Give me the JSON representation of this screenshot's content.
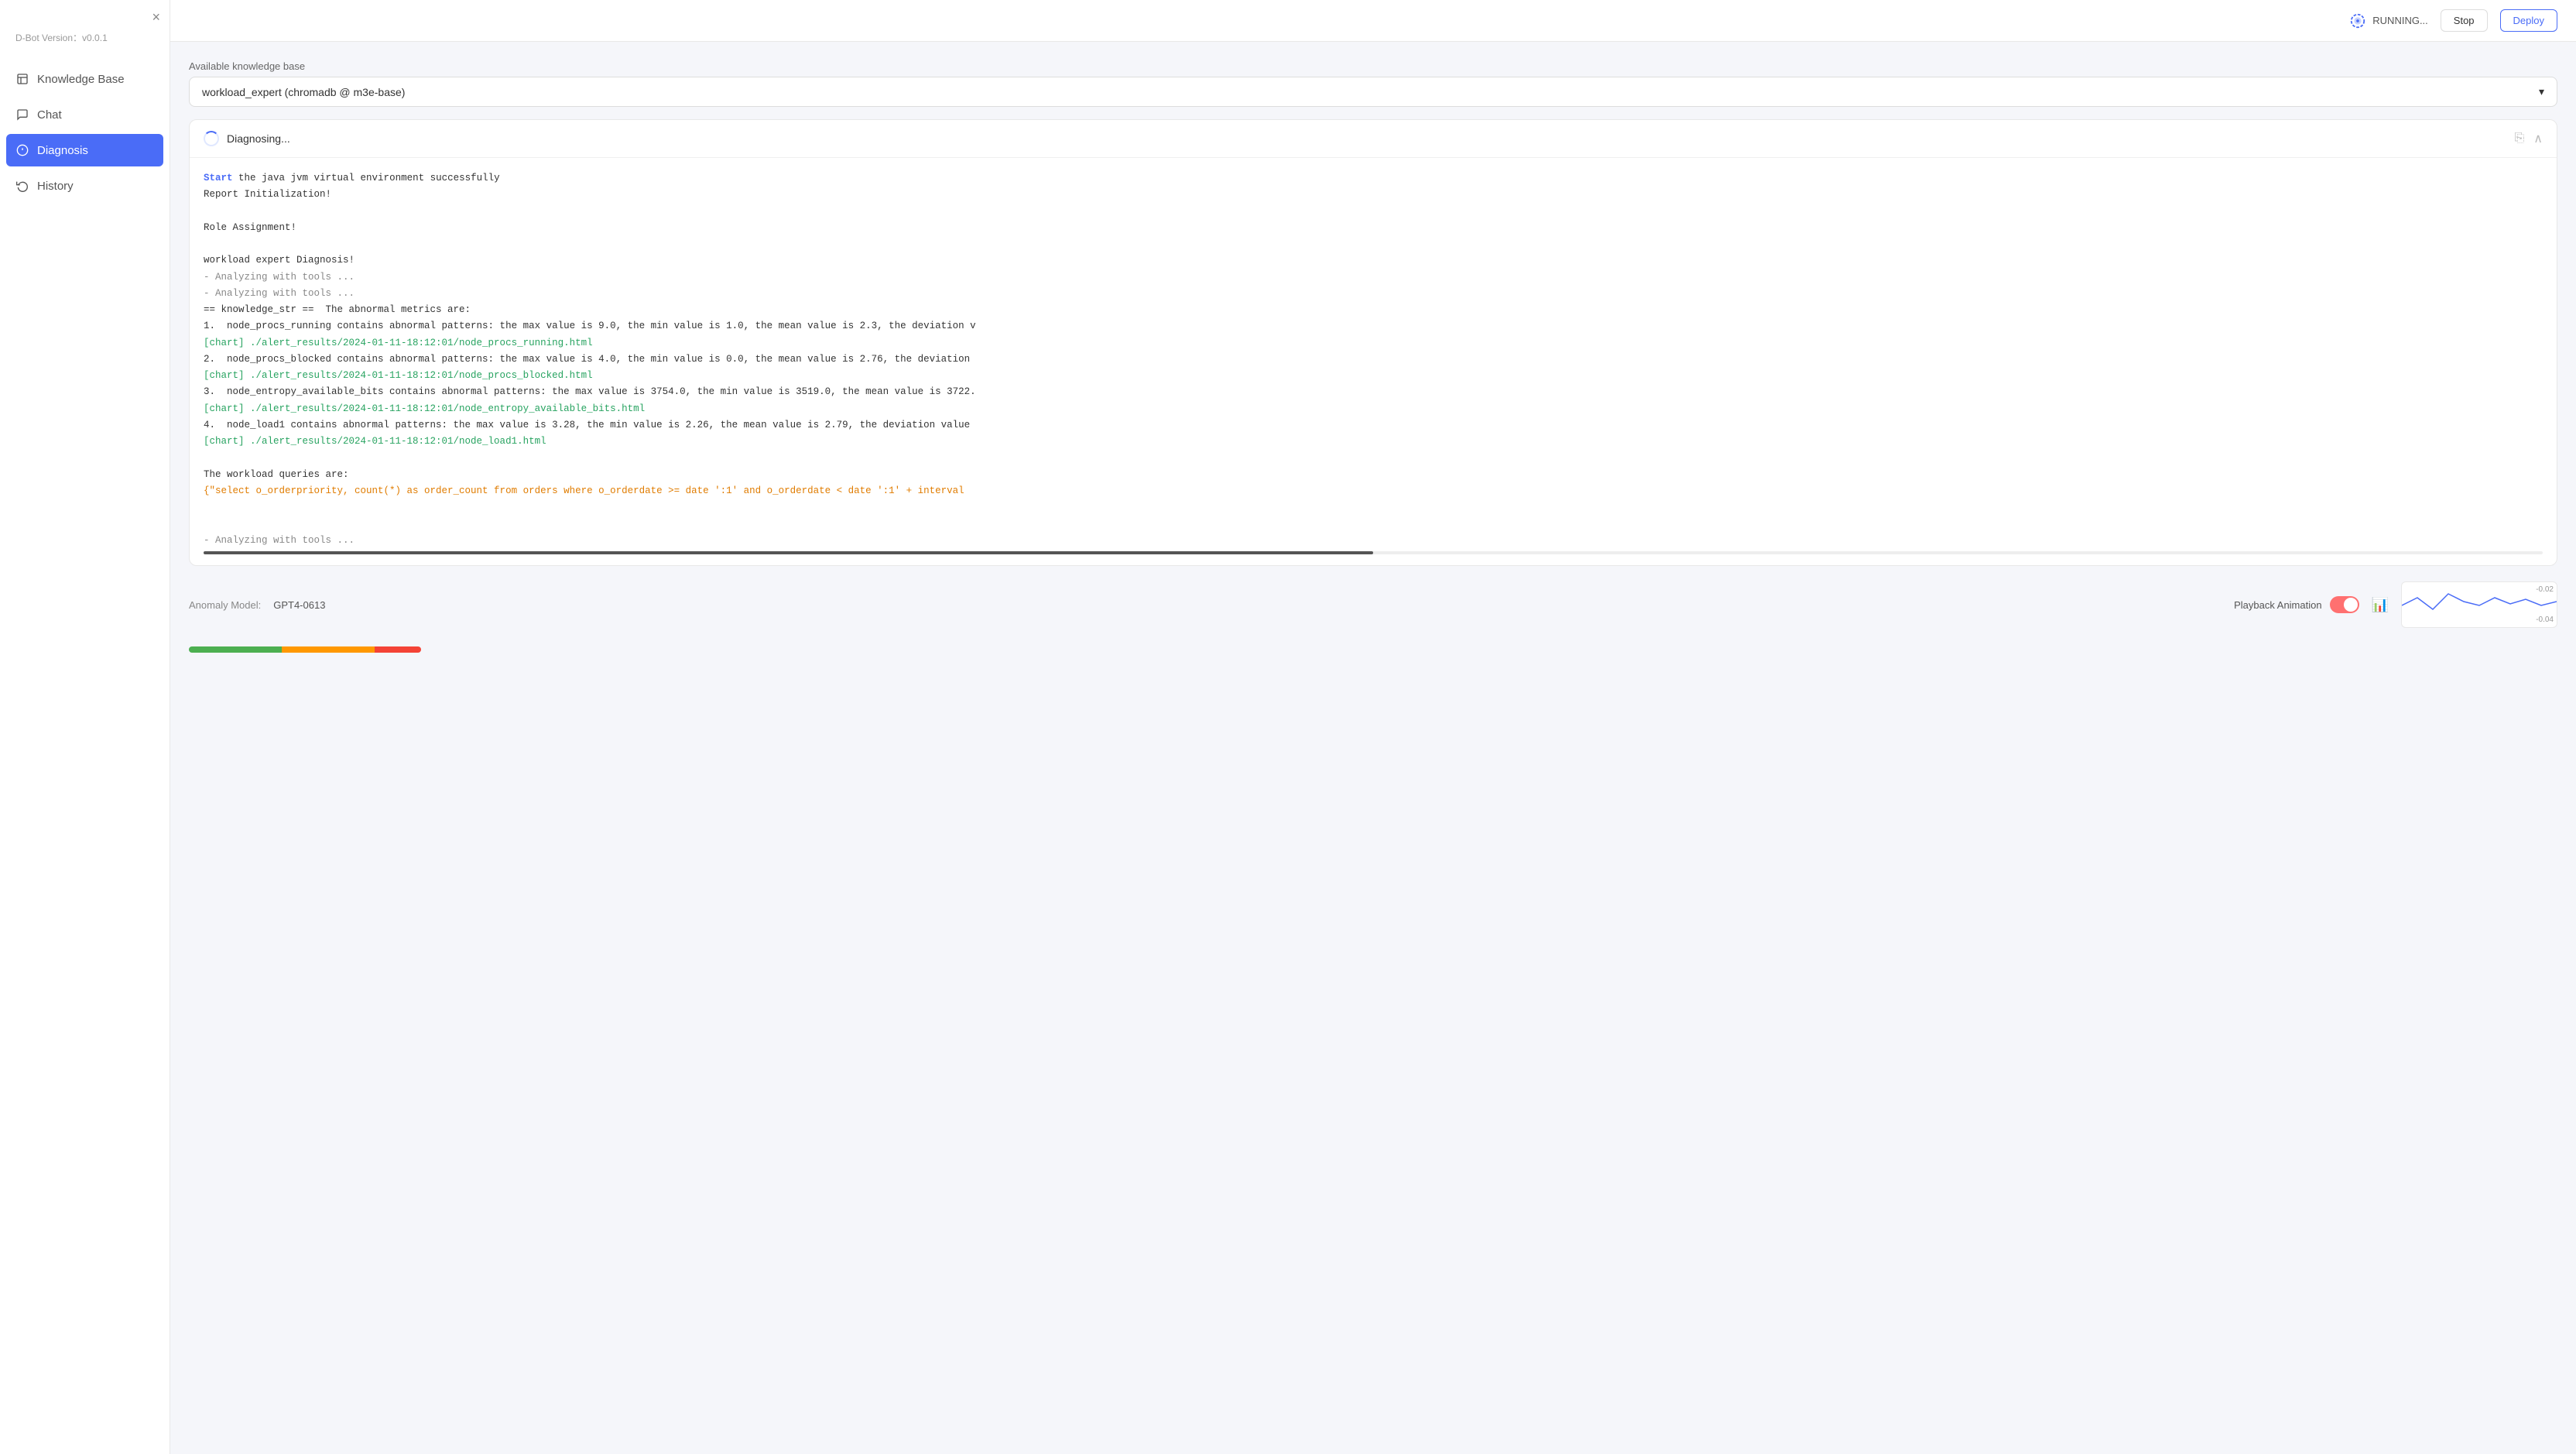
{
  "app": {
    "title": "D-Bot",
    "version_label": "D-Bot Version：",
    "version": "v0.0.1"
  },
  "topbar": {
    "running_label": "RUNNING...",
    "stop_label": "Stop",
    "deploy_label": "Deploy"
  },
  "sidebar": {
    "close_icon": "×",
    "items": [
      {
        "id": "knowledge-base",
        "label": "Knowledge Base",
        "icon": "book",
        "active": false
      },
      {
        "id": "chat",
        "label": "Chat",
        "icon": "chat",
        "active": false
      },
      {
        "id": "diagnosis",
        "label": "Diagnosis",
        "icon": "diagnosis",
        "active": true
      },
      {
        "id": "history",
        "label": "History",
        "icon": "history",
        "active": false
      }
    ]
  },
  "knowledge_base": {
    "label": "Available knowledge base",
    "selected": "workload_expert (chromadb @ m3e-base)"
  },
  "diagnosis": {
    "title": "Diagnosing...",
    "content_lines": [
      {
        "type": "normal",
        "text": "Start the java jvm virtual environment successfully",
        "prefix": "Start",
        "prefix_color": "blue"
      },
      {
        "type": "normal",
        "text": "Report Initialization!"
      },
      {
        "type": "blank"
      },
      {
        "type": "normal",
        "text": "Role Assignment!"
      },
      {
        "type": "blank"
      },
      {
        "type": "normal",
        "text": "workload expert Diagnosis!"
      },
      {
        "type": "dash",
        "text": "- Analyzing with tools ..."
      },
      {
        "type": "dash",
        "text": "- Analyzing with tools ..."
      },
      {
        "type": "normal",
        "text": "== knowledge_str ==  The abnormal metrics are:"
      },
      {
        "type": "normal",
        "text": "1.  node_procs_running contains abnormal patterns: the max value is 9.0, the min value is 1.0, the mean value is 2.3, the deviation v"
      },
      {
        "type": "link",
        "text": "[chart] ./alert_results/2024-01-11-18:12:01/node_procs_running.html"
      },
      {
        "type": "normal",
        "text": "2.  node_procs_blocked contains abnormal patterns: the max value is 4.0, the min value is 0.0, the mean value is 2.76, the deviation"
      },
      {
        "type": "link",
        "text": "[chart] ./alert_results/2024-01-11-18:12:01/node_procs_blocked.html"
      },
      {
        "type": "normal",
        "text": "3.  node_entropy_available_bits contains abnormal patterns: the max value is 3754.0, the min value is 3519.0, the mean value is 3722."
      },
      {
        "type": "link",
        "text": "[chart] ./alert_results/2024-01-11-18:12:01/node_entropy_available_bits.html"
      },
      {
        "type": "normal",
        "text": "4.  node_load1 contains abnormal patterns: the max value is 3.28, the min value is 2.26, the mean value is 2.79, the deviation value"
      },
      {
        "type": "link",
        "text": "[chart] ./alert_results/2024-01-11-18:12:01/node_load1.html"
      },
      {
        "type": "blank"
      },
      {
        "type": "normal",
        "text": "The workload queries are:"
      },
      {
        "type": "query",
        "text": "{\"select o_orderpriority, count(*) as order_count from orders where o_orderdate >= date ':1' and o_orderdate < date ':1' + interval"
      }
    ],
    "analyzing_footer": "- Analyzing with tools ...",
    "progress_pct": 50,
    "copy_icon": "⎘",
    "collapse_icon": "∧"
  },
  "bottom_bar": {
    "model_label": "Anomaly Model:",
    "model_value": "GPT4-0613",
    "playback_label": "Playback Animation",
    "toggle_state": true
  },
  "chart": {
    "y_max": "-0.02",
    "y_min": "-0.04"
  }
}
